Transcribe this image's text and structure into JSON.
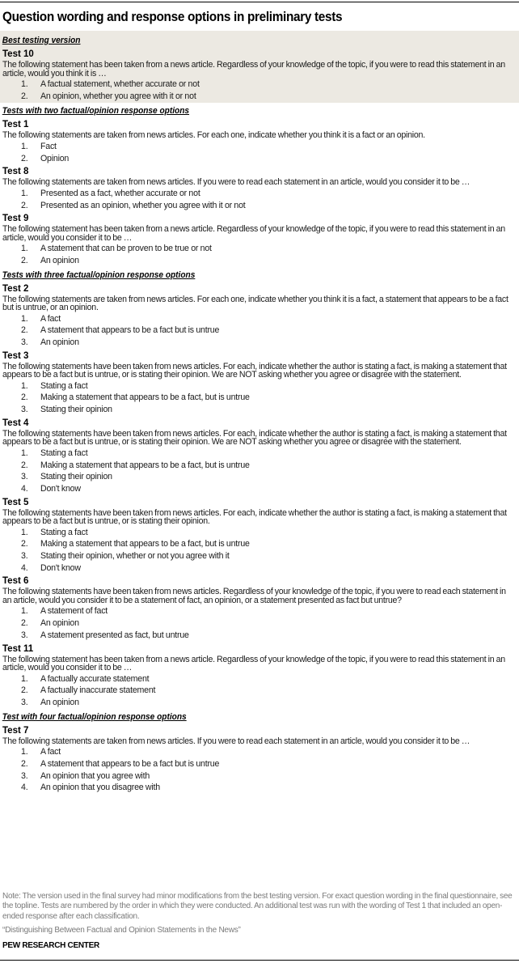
{
  "title": "Question wording and response options in preliminary tests",
  "sections": [
    {
      "heading": "Best testing version",
      "shaded": true,
      "tests": [
        {
          "label": "Test 10",
          "prompt": "The following statement has been taken from a news article. Regardless of your knowledge of the topic, if you were to read this statement in an article, would you think it is …",
          "options": [
            "A factual statement, whether accurate or not",
            "An opinion, whether you agree with it or not"
          ]
        }
      ]
    },
    {
      "heading": "Tests with two factual/opinion response options",
      "shaded": false,
      "tests": [
        {
          "label": "Test 1",
          "prompt": "The following statements are taken from news articles. For each one, indicate whether you think it is a fact or an opinion.",
          "options": [
            "Fact",
            "Opinion"
          ]
        },
        {
          "label": "Test 8",
          "prompt": "The following statements are taken from news articles. If you were to read  each statement in an article, would you consider it to be …",
          "options": [
            "Presented as a fact, whether accurate or not",
            "Presented as an opinion, whether you agree with it or not"
          ]
        },
        {
          "label": "Test 9",
          "prompt": "The following statement has been taken from a news article. Regardless of your knowledge of the topic, if you were to read this statement in an article, would you consider it to be …",
          "options": [
            "A statement that can be proven to be true or not",
            "An opinion"
          ]
        }
      ]
    },
    {
      "heading": "Tests with three factual/opinion response options",
      "shaded": false,
      "tests": [
        {
          "label": "Test 2",
          "prompt": "The following statements are taken from news articles. For each one, indicate whether you think it is a fact, a statement that appears to be a fact but is untrue, or an opinion.",
          "options": [
            "A fact",
            "A statement that appears  to be a fact but is untrue",
            "An opinion"
          ]
        },
        {
          "label": "Test 3",
          "prompt": "The following statements have been  taken from news articles. For each, indicate whether the author is stating a fact, is making a statement that appears to be a fact but is untrue, or is stating their opinion. We are  NOT asking whether you agree or disagree with the statement.",
          "options": [
            "Stating a fact",
            "Making a statement that appears  to be a fact, but is untrue",
            "Stating their opinion"
          ]
        },
        {
          "label": "Test 4",
          "prompt": "The following statements have been  taken from news articles. For each, indicate whether the author is stating a fact, is making a statement that appears to be a fact but is untrue, or is stating their opinion. We are  NOT asking whether you agree or disagree with the statement.",
          "options": [
            "Stating a fact",
            "Making a statement that appears  to be a fact, but is untrue",
            "Stating their opinion",
            "Don't know"
          ]
        },
        {
          "label": "Test 5",
          "prompt": "The following statements have been  taken from news articles. For each, indicate whether the author is stating a fact, is making a statement that appears to be a fact but is untrue, or is stating their opinion.",
          "options": [
            "Stating a fact",
            "Making a statement that appears  to be a fact, but is untrue",
            "Stating their opinion, whether or  not you agree with it",
            "Don't know"
          ]
        },
        {
          "label": "Test 6",
          "prompt": "The following statements have been  taken from news articles. Regardless of your knowledge of the topic, if you were to read each statement in an article, would you consider it to be a statement of fact, an opinion, or a statement presented as fact but untrue?",
          "options": [
            "A statement of fact",
            "An opinion",
            "A statement presented as fact, but untrue"
          ]
        },
        {
          "label": "Test 11",
          "prompt": "The following statement has been taken from a news article. Regardless of your knowledge of the topic, if you were to read this statement in an article, would you consider it to be …",
          "options": [
            "A factually accurate statement",
            "A factually inaccurate statement",
            "An opinion"
          ]
        }
      ]
    },
    {
      "heading": "Test with four factual/opinion response options",
      "shaded": false,
      "tests": [
        {
          "label": "Test 7",
          "prompt": "The following statements are taken from news articles. If you were to read  each statement in an article, would you consider it to be …",
          "options": [
            "A fact",
            "A statement that appears  to be a fact but is untrue",
            "An opinion that you agree with",
            "An opinion that you disagree with"
          ]
        }
      ]
    }
  ],
  "note": "Note: The version used in the final survey had minor modifications from the best testing version. For exact question wording in the final questionnaire, see the topline. Tests are numbered by the order in which they were conducted. An additional test was run with the wording of Test 1 that included an open-ended response after each classification.",
  "source": "“Distinguishing Between Factual and Opinion Statements in the News”",
  "credit": "PEW RESEARCH CENTER",
  "colors": {
    "shaded_box": "#ece9e2",
    "note_text": "#7a7a7a",
    "rule": "#000000"
  }
}
